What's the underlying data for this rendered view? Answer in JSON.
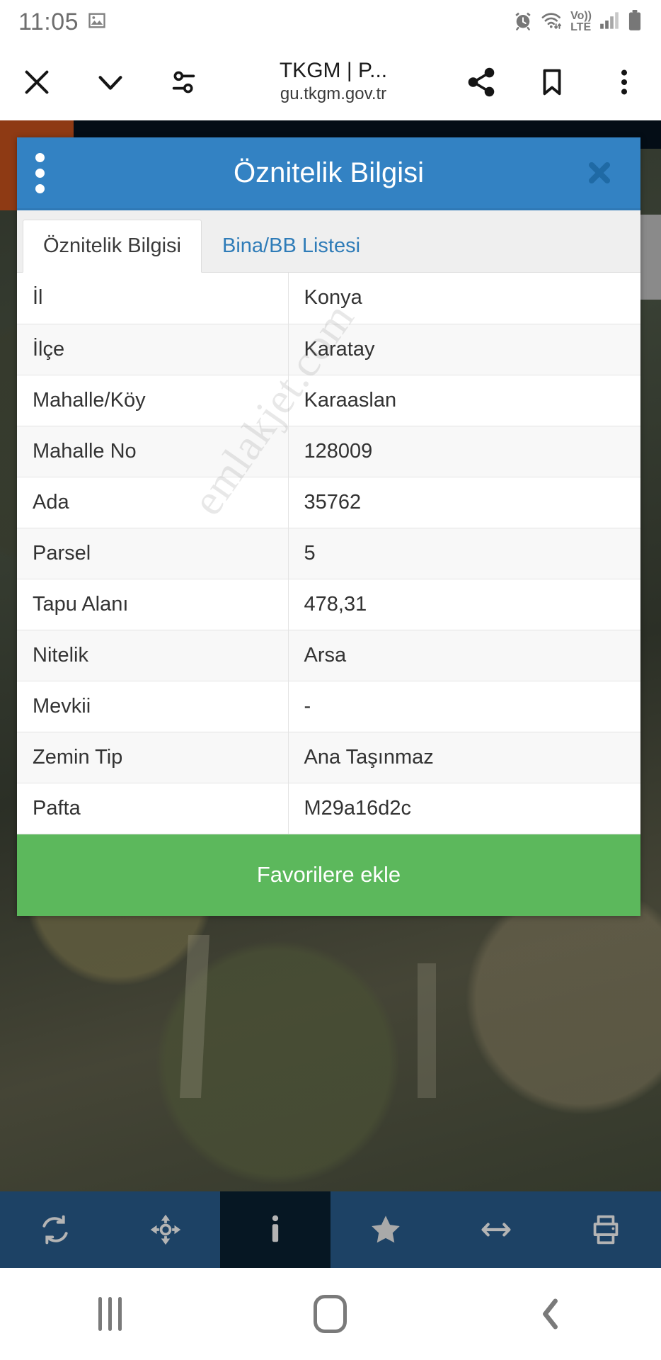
{
  "status_bar": {
    "clock": "11:05",
    "icons_left": [
      "image-icon"
    ],
    "icons_right": [
      "alarm-icon",
      "wifi-icon",
      "volte-icon",
      "signal-icon",
      "battery-icon"
    ],
    "volte_label": "Vo))",
    "lte_label": "LTE"
  },
  "browser": {
    "close_icon": "close-icon",
    "collapse_icon": "chevron-down-icon",
    "settings_icon": "page-settings-icon",
    "title": "TKGM | P...",
    "url": "gu.tkgm.gov.tr",
    "share_icon": "share-icon",
    "bookmark_icon": "bookmark-icon",
    "menu_icon": "overflow-menu-icon"
  },
  "dialog": {
    "title": "Öznitelik Bilgisi",
    "kebab_icon": "kebab-menu-icon",
    "close_icon": "close-icon",
    "header_color": "#3382c3",
    "tabs": [
      {
        "label": "Öznitelik Bilgisi",
        "active": true
      },
      {
        "label": "Bina/BB Listesi",
        "active": false
      }
    ],
    "attributes": [
      {
        "key": "İl",
        "value": "Konya"
      },
      {
        "key": "İlçe",
        "value": "Karatay"
      },
      {
        "key": "Mahalle/Köy",
        "value": "Karaaslan"
      },
      {
        "key": "Mahalle No",
        "value": "128009"
      },
      {
        "key": "Ada",
        "value": "35762"
      },
      {
        "key": "Parsel",
        "value": "5"
      },
      {
        "key": "Tapu Alanı",
        "value": "478,31"
      },
      {
        "key": "Nitelik",
        "value": "Arsa"
      },
      {
        "key": "Mevkii",
        "value": "-"
      },
      {
        "key": "Zemin Tip",
        "value": "Ana Taşınmaz"
      },
      {
        "key": "Pafta",
        "value": "M29a16d2c"
      }
    ],
    "favorite_button": {
      "label": "Favorilere ekle",
      "color": "#5cb85c"
    }
  },
  "watermark": {
    "text": "emlakjet.com"
  },
  "app_toolbar": {
    "background": "#1d4265",
    "active_background": "#061723",
    "items": [
      {
        "name": "refresh-icon",
        "active": false
      },
      {
        "name": "locate-icon",
        "active": false
      },
      {
        "name": "info-icon",
        "active": true
      },
      {
        "name": "star-icon",
        "active": false
      },
      {
        "name": "measure-icon",
        "active": false
      },
      {
        "name": "print-icon",
        "active": false
      }
    ]
  },
  "nav_bar": {
    "recents_icon": "recents-icon",
    "home_icon": "home-icon",
    "back_icon": "back-icon"
  }
}
